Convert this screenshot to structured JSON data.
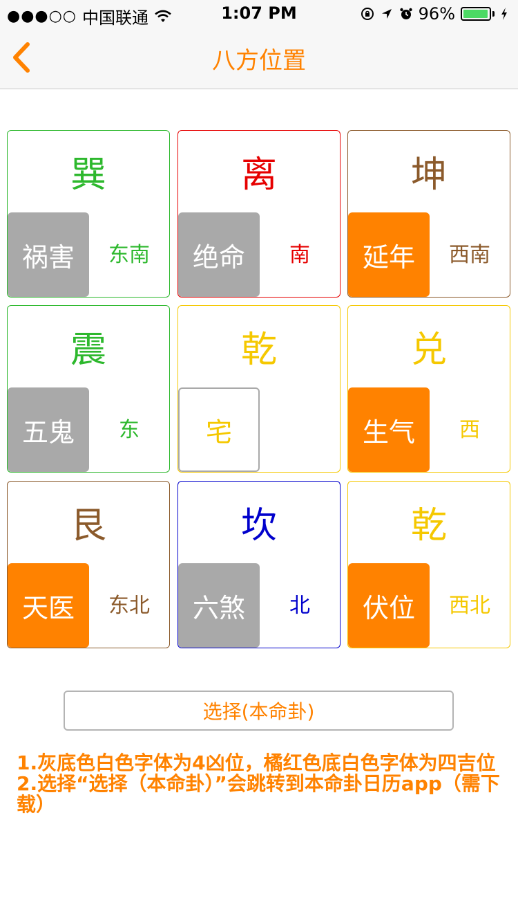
{
  "status_bar": {
    "signal_dots": "●●●○○",
    "carrier": "中国联通",
    "time": "1:07 PM",
    "battery_percent": "96%",
    "battery_level": 0.96
  },
  "nav": {
    "title": "八方位置"
  },
  "colors": {
    "accent": "#ff8200",
    "green": "#2db82d",
    "red": "#e60000",
    "brown": "#8b5a2b",
    "yellow": "#f5c800",
    "blue": "#0000cc",
    "gray_box": "#a9a9a9"
  },
  "cells": [
    {
      "trigram": "巽",
      "star": "祸害",
      "direction": "东南",
      "color": "#2db82d",
      "star_style": "gray"
    },
    {
      "trigram": "离",
      "star": "绝命",
      "direction": "南",
      "color": "#e60000",
      "star_style": "gray"
    },
    {
      "trigram": "坤",
      "star": "延年",
      "direction": "西南",
      "color": "#8b5a2b",
      "star_style": "orange"
    },
    {
      "trigram": "震",
      "star": "五鬼",
      "direction": "东",
      "color": "#2db82d",
      "star_style": "gray"
    },
    {
      "trigram": "乾",
      "star": "宅",
      "direction": "",
      "color": "#f5c800",
      "star_style": "outline"
    },
    {
      "trigram": "兑",
      "star": "生气",
      "direction": "西",
      "color": "#f5c800",
      "star_style": "orange"
    },
    {
      "trigram": "艮",
      "star": "天医",
      "direction": "东北",
      "color": "#8b5a2b",
      "star_style": "orange"
    },
    {
      "trigram": "坎",
      "star": "六煞",
      "direction": "北",
      "color": "#0000cc",
      "star_style": "gray"
    },
    {
      "trigram": "乾",
      "star": "伏位",
      "direction": "西北",
      "color": "#f5c800",
      "star_style": "orange"
    }
  ],
  "select_button": {
    "label": "选择(本命卦)"
  },
  "notes": {
    "line1": "1.灰底色白色字体为4凶位，橘红色底白色字体为四吉位",
    "line2": "2.选择“选择（本命卦）”会跳转到本命卦日历app（需下载）"
  }
}
